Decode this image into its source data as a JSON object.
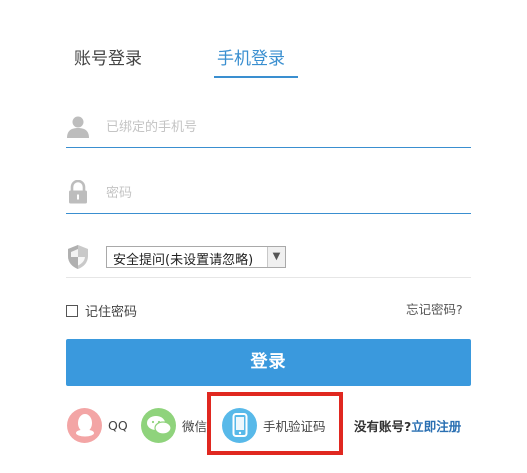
{
  "tabs": {
    "account_label": "账号登录",
    "phone_label": "手机登录"
  },
  "form": {
    "phone_placeholder": "已绑定的手机号",
    "password_placeholder": "密码",
    "security_question_selected": "安全提问(未设置请忽略)"
  },
  "options": {
    "remember_label": "记住密码",
    "forgot_label": "忘记密码?"
  },
  "login_button": "登录",
  "social": {
    "qq_label": "QQ",
    "wechat_label": "微信",
    "sms_label": "手机验证码"
  },
  "register": {
    "prompt": "没有账号?",
    "link": "立即注册"
  },
  "colors": {
    "accent": "#3a8fd0",
    "button": "#3a99dd",
    "highlight": "#e02820",
    "qq": "#f3a5a5",
    "wechat": "#8fd37c",
    "sms": "#58b9e9"
  },
  "icons": [
    "user-icon",
    "lock-icon",
    "shield-icon",
    "qq-icon",
    "wechat-icon",
    "phone-icon"
  ]
}
